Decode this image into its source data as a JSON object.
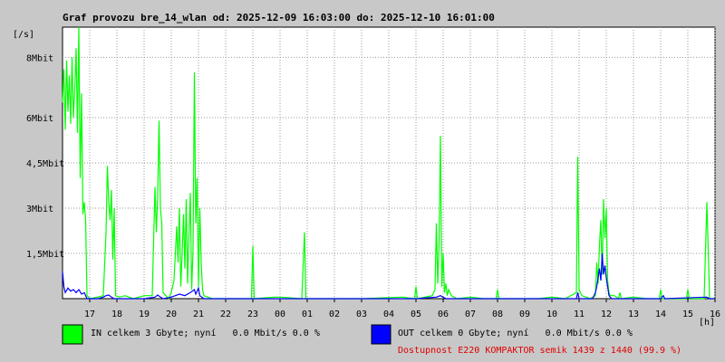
{
  "title": "Graf provozu bre_14_wlan od: 2025-12-09 16:03:00 do: 2025-12-10 16:01:00",
  "legend": {
    "in_text": "IN celkem 3 Gbyte; nyní   0.0 Mbit/s 0.0 %",
    "out_text": "OUT celkem 0 Gbyte; nyní   0.0 Mbit/s 0.0 %",
    "availability": "Dostupnost E220 KOMPAKTOR semik 1439 z 1440 (99.9 %)"
  },
  "colors": {
    "in": "#00ff00",
    "out": "#0000ff",
    "grid": "#9a9a9a",
    "plot_bg": "#ffffff",
    "page_bg": "#c8c8c8",
    "availability": "#e00000"
  },
  "chart_data": {
    "type": "line",
    "title": "Graf provozu bre_14_wlan od: 2025-12-09 16:03:00 do: 2025-12-10 16:01:00",
    "ylabel": "[/s]",
    "xlabel": "[h]",
    "ylim": [
      0,
      9
    ],
    "xlim": [
      16.0,
      40.0
    ],
    "y_unit": "Mbit/s",
    "y_ticks": [
      {
        "value": 1.5,
        "label": "1,5Mbit"
      },
      {
        "value": 3,
        "label": "3Mbit"
      },
      {
        "value": 4.5,
        "label": "4,5Mbit"
      },
      {
        "value": 6,
        "label": "6Mbit"
      },
      {
        "value": 8,
        "label": "8Mbit"
      }
    ],
    "x_ticks": [
      {
        "value": 17,
        "label": "17"
      },
      {
        "value": 18,
        "label": "18"
      },
      {
        "value": 19,
        "label": "19"
      },
      {
        "value": 20,
        "label": "20"
      },
      {
        "value": 21,
        "label": "21"
      },
      {
        "value": 22,
        "label": "22"
      },
      {
        "value": 23,
        "label": "23"
      },
      {
        "value": 24,
        "label": "00"
      },
      {
        "value": 25,
        "label": "01"
      },
      {
        "value": 26,
        "label": "02"
      },
      {
        "value": 27,
        "label": "03"
      },
      {
        "value": 28,
        "label": "04"
      },
      {
        "value": 29,
        "label": "05"
      },
      {
        "value": 30,
        "label": "06"
      },
      {
        "value": 31,
        "label": "07"
      },
      {
        "value": 32,
        "label": "08"
      },
      {
        "value": 33,
        "label": "09"
      },
      {
        "value": 34,
        "label": "10"
      },
      {
        "value": 35,
        "label": "11"
      },
      {
        "value": 36,
        "label": "12"
      },
      {
        "value": 37,
        "label": "13"
      },
      {
        "value": 38,
        "label": "14"
      },
      {
        "value": 39,
        "label": "15"
      },
      {
        "value": 40,
        "label": "16"
      }
    ],
    "grid": true,
    "series": [
      {
        "name": "IN",
        "color": "#00ff00",
        "points": [
          [
            16.0,
            6.5
          ],
          [
            16.05,
            7.6
          ],
          [
            16.1,
            5.6
          ],
          [
            16.15,
            7.9
          ],
          [
            16.2,
            6.2
          ],
          [
            16.25,
            7.4
          ],
          [
            16.3,
            5.8
          ],
          [
            16.35,
            8.0
          ],
          [
            16.4,
            6.0
          ],
          [
            16.45,
            6.9
          ],
          [
            16.5,
            8.3
          ],
          [
            16.55,
            5.5
          ],
          [
            16.6,
            9.0
          ],
          [
            16.65,
            4.0
          ],
          [
            16.7,
            6.8
          ],
          [
            16.75,
            2.8
          ],
          [
            16.8,
            3.2
          ],
          [
            16.85,
            2.6
          ],
          [
            16.9,
            0.1
          ],
          [
            17.0,
            0.0
          ],
          [
            17.3,
            0.05
          ],
          [
            17.5,
            0.1
          ],
          [
            17.6,
            2.2
          ],
          [
            17.65,
            4.4
          ],
          [
            17.7,
            3.2
          ],
          [
            17.75,
            2.6
          ],
          [
            17.8,
            3.6
          ],
          [
            17.85,
            1.3
          ],
          [
            17.9,
            3.0
          ],
          [
            17.95,
            0.1
          ],
          [
            18.1,
            0.05
          ],
          [
            18.3,
            0.1
          ],
          [
            18.6,
            0.0
          ],
          [
            19.0,
            0.1
          ],
          [
            19.3,
            0.1
          ],
          [
            19.4,
            3.7
          ],
          [
            19.45,
            2.2
          ],
          [
            19.5,
            3.4
          ],
          [
            19.55,
            5.9
          ],
          [
            19.6,
            3.0
          ],
          [
            19.65,
            2.5
          ],
          [
            19.7,
            0.2
          ],
          [
            19.8,
            0.1
          ],
          [
            19.9,
            0.0
          ],
          [
            20.0,
            0.2
          ],
          [
            20.1,
            0.6
          ],
          [
            20.2,
            2.4
          ],
          [
            20.25,
            1.2
          ],
          [
            20.3,
            3.0
          ],
          [
            20.35,
            0.4
          ],
          [
            20.4,
            1.5
          ],
          [
            20.45,
            2.8
          ],
          [
            20.5,
            1.0
          ],
          [
            20.55,
            3.3
          ],
          [
            20.6,
            0.5
          ],
          [
            20.65,
            2.1
          ],
          [
            20.7,
            3.5
          ],
          [
            20.75,
            0.3
          ],
          [
            20.8,
            1.6
          ],
          [
            20.85,
            7.5
          ],
          [
            20.9,
            2.5
          ],
          [
            20.95,
            4.0
          ],
          [
            21.0,
            0.4
          ],
          [
            21.05,
            3.0
          ],
          [
            21.1,
            1.2
          ],
          [
            21.15,
            0.3
          ],
          [
            21.2,
            0.1
          ],
          [
            21.5,
            0.0
          ],
          [
            22.0,
            0.0
          ],
          [
            22.6,
            0.0
          ],
          [
            22.95,
            0.0
          ],
          [
            23.0,
            1.75
          ],
          [
            23.05,
            0.0
          ],
          [
            23.8,
            0.05
          ],
          [
            24.0,
            0.05
          ],
          [
            24.8,
            0.0
          ],
          [
            24.9,
            2.2
          ],
          [
            24.95,
            0.0
          ],
          [
            25.5,
            0.0
          ],
          [
            27.0,
            0.0
          ],
          [
            28.5,
            0.05
          ],
          [
            28.95,
            0.0
          ],
          [
            29.0,
            0.4
          ],
          [
            29.05,
            0.0
          ],
          [
            29.6,
            0.1
          ],
          [
            29.7,
            0.3
          ],
          [
            29.75,
            2.5
          ],
          [
            29.8,
            0.5
          ],
          [
            29.85,
            1.8
          ],
          [
            29.9,
            5.4
          ],
          [
            29.95,
            0.4
          ],
          [
            30.0,
            1.5
          ],
          [
            30.05,
            0.2
          ],
          [
            30.1,
            0.5
          ],
          [
            30.15,
            0.1
          ],
          [
            30.2,
            0.3
          ],
          [
            30.3,
            0.1
          ],
          [
            30.5,
            0.0
          ],
          [
            31.0,
            0.05
          ],
          [
            31.5,
            0.0
          ],
          [
            31.95,
            0.0
          ],
          [
            32.0,
            0.3
          ],
          [
            32.05,
            0.0
          ],
          [
            32.5,
            0.0
          ],
          [
            33.0,
            0.0
          ],
          [
            33.5,
            0.0
          ],
          [
            34.0,
            0.05
          ],
          [
            34.5,
            0.0
          ],
          [
            34.9,
            0.2
          ],
          [
            34.95,
            4.7
          ],
          [
            35.0,
            0.3
          ],
          [
            35.1,
            0.1
          ],
          [
            35.4,
            0.0
          ],
          [
            35.5,
            0.05
          ],
          [
            35.6,
            0.1
          ],
          [
            35.65,
            1.2
          ],
          [
            35.7,
            0.5
          ],
          [
            35.75,
            1.8
          ],
          [
            35.8,
            2.6
          ],
          [
            35.85,
            0.8
          ],
          [
            35.9,
            3.3
          ],
          [
            35.95,
            2.0
          ],
          [
            36.0,
            3.0
          ],
          [
            36.05,
            0.6
          ],
          [
            36.1,
            0.2
          ],
          [
            36.15,
            0.1
          ],
          [
            36.3,
            0.1
          ],
          [
            36.45,
            0.0
          ],
          [
            36.5,
            0.2
          ],
          [
            36.55,
            0.0
          ],
          [
            37.0,
            0.05
          ],
          [
            37.5,
            0.0
          ],
          [
            37.95,
            0.0
          ],
          [
            38.0,
            0.3
          ],
          [
            38.05,
            0.0
          ],
          [
            38.5,
            0.0
          ],
          [
            38.95,
            0.0
          ],
          [
            39.0,
            0.3
          ],
          [
            39.05,
            0.0
          ],
          [
            39.6,
            0.0
          ],
          [
            39.7,
            3.2
          ],
          [
            39.8,
            0.0
          ],
          [
            40.0,
            0.0
          ]
        ]
      },
      {
        "name": "OUT",
        "color": "#0000ff",
        "points": [
          [
            16.0,
            0.9
          ],
          [
            16.05,
            0.4
          ],
          [
            16.1,
            0.2
          ],
          [
            16.2,
            0.35
          ],
          [
            16.3,
            0.25
          ],
          [
            16.4,
            0.3
          ],
          [
            16.5,
            0.2
          ],
          [
            16.6,
            0.3
          ],
          [
            16.7,
            0.15
          ],
          [
            16.8,
            0.2
          ],
          [
            16.85,
            0.1
          ],
          [
            16.9,
            0.0
          ],
          [
            17.0,
            0.0
          ],
          [
            17.3,
            0.0
          ],
          [
            17.5,
            0.05
          ],
          [
            17.6,
            0.1
          ],
          [
            17.7,
            0.12
          ],
          [
            17.8,
            0.05
          ],
          [
            17.9,
            0.0
          ],
          [
            19.0,
            0.0
          ],
          [
            19.4,
            0.05
          ],
          [
            19.5,
            0.12
          ],
          [
            19.6,
            0.05
          ],
          [
            19.7,
            0.0
          ],
          [
            20.0,
            0.05
          ],
          [
            20.3,
            0.15
          ],
          [
            20.5,
            0.1
          ],
          [
            20.7,
            0.2
          ],
          [
            20.85,
            0.3
          ],
          [
            20.9,
            0.15
          ],
          [
            21.0,
            0.35
          ],
          [
            21.05,
            0.1
          ],
          [
            21.2,
            0.0
          ],
          [
            23.0,
            0.0
          ],
          [
            25.0,
            0.0
          ],
          [
            29.0,
            0.0
          ],
          [
            29.75,
            0.05
          ],
          [
            29.9,
            0.1
          ],
          [
            30.0,
            0.05
          ],
          [
            30.1,
            0.0
          ],
          [
            34.9,
            0.0
          ],
          [
            34.95,
            0.2
          ],
          [
            35.0,
            0.0
          ],
          [
            35.5,
            0.0
          ],
          [
            35.6,
            0.2
          ],
          [
            35.65,
            0.4
          ],
          [
            35.7,
            0.7
          ],
          [
            35.75,
            1.0
          ],
          [
            35.8,
            0.6
          ],
          [
            35.85,
            1.5
          ],
          [
            35.9,
            0.8
          ],
          [
            35.95,
            1.1
          ],
          [
            36.0,
            0.7
          ],
          [
            36.05,
            0.4
          ],
          [
            36.1,
            0.1
          ],
          [
            36.2,
            0.0
          ],
          [
            38.0,
            0.0
          ],
          [
            38.1,
            0.1
          ],
          [
            38.15,
            0.0
          ],
          [
            39.7,
            0.05
          ],
          [
            39.8,
            0.0
          ],
          [
            40.0,
            0.0
          ]
        ]
      }
    ]
  }
}
